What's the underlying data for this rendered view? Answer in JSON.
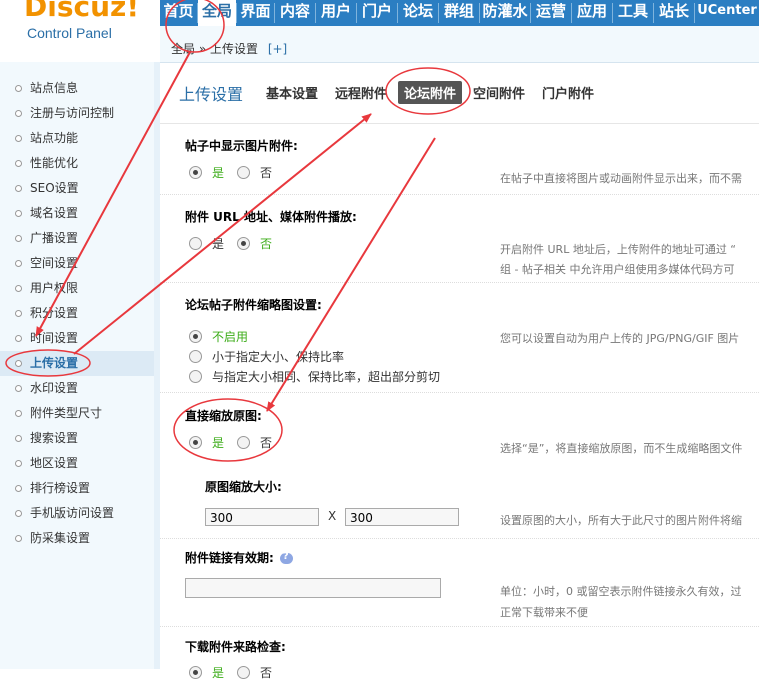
{
  "logo": {
    "text": "Discuz!",
    "subtitle": "Control Panel"
  },
  "topnav": {
    "items": [
      "首页",
      "全局",
      "界面",
      "内容",
      "用户",
      "门户",
      "论坛",
      "群组",
      "防灌水",
      "运营",
      "应用",
      "工具",
      "站长",
      "UCenter"
    ],
    "active_index": 1
  },
  "breadcrumb": {
    "text": "全局 » 上传设置",
    "plus": "[+]"
  },
  "sidebar": {
    "items": [
      "站点信息",
      "注册与访问控制",
      "站点功能",
      "性能优化",
      "SEO设置",
      "域名设置",
      "广播设置",
      "空间设置",
      "用户权限",
      "积分设置",
      "时间设置",
      "上传设置",
      "水印设置",
      "附件类型尺寸",
      "搜索设置",
      "地区设置",
      "排行榜设置",
      "手机版访问设置",
      "防采集设置"
    ],
    "active_index": 11
  },
  "main": {
    "title": "上传设置",
    "tabs": [
      "基本设置",
      "远程附件",
      "论坛附件",
      "空间附件",
      "门户附件"
    ],
    "active_tab_index": 2
  },
  "sections": {
    "s1": {
      "title": "帖子中显示图片附件:",
      "yes": "是",
      "no": "否",
      "tip": "在帖子中直接将图片或动画附件显示出来，而不需"
    },
    "s2": {
      "title": "附件 URL 地址、媒体附件播放:",
      "yes": "是",
      "no": "否",
      "tip1": "开启附件 URL 地址后，上传附件的地址可通过 “",
      "tip2": "组 - 帖子相关 中允许用户组使用多媒体代码方可"
    },
    "s3": {
      "title": "论坛帖子附件缩略图设置:",
      "opt1": "不启用",
      "opt2": "小于指定大小、保持比率",
      "opt3": "与指定大小相同、保持比率，超出部分剪切",
      "tip": "您可以设置自动为用户上传的 JPG/PNG/GIF 图片"
    },
    "s4": {
      "title": "直接缩放原图:",
      "yes": "是",
      "no": "否",
      "tip": "选择“是”，将直接缩放原图，而不生成缩略图文件"
    },
    "s5": {
      "title": "原图缩放大小:",
      "width": "300",
      "x": "X",
      "height": "300",
      "tip": "设置原图的大小，所有大于此尺寸的图片附件将缩"
    },
    "s6": {
      "title": "附件链接有效期:",
      "value": "",
      "tip1": "单位：小时，0 或留空表示附件链接永久有效，过",
      "tip2": "正常下载带来不便"
    },
    "s7": {
      "title": "下载附件来路检查:",
      "yes": "是",
      "no": "否"
    }
  },
  "colors": {
    "nav": "#2b7ec2",
    "accent": "#2b6fa7",
    "logo": "#f29200",
    "annotation": "#e8383d",
    "yes_green": "#3cac19"
  }
}
